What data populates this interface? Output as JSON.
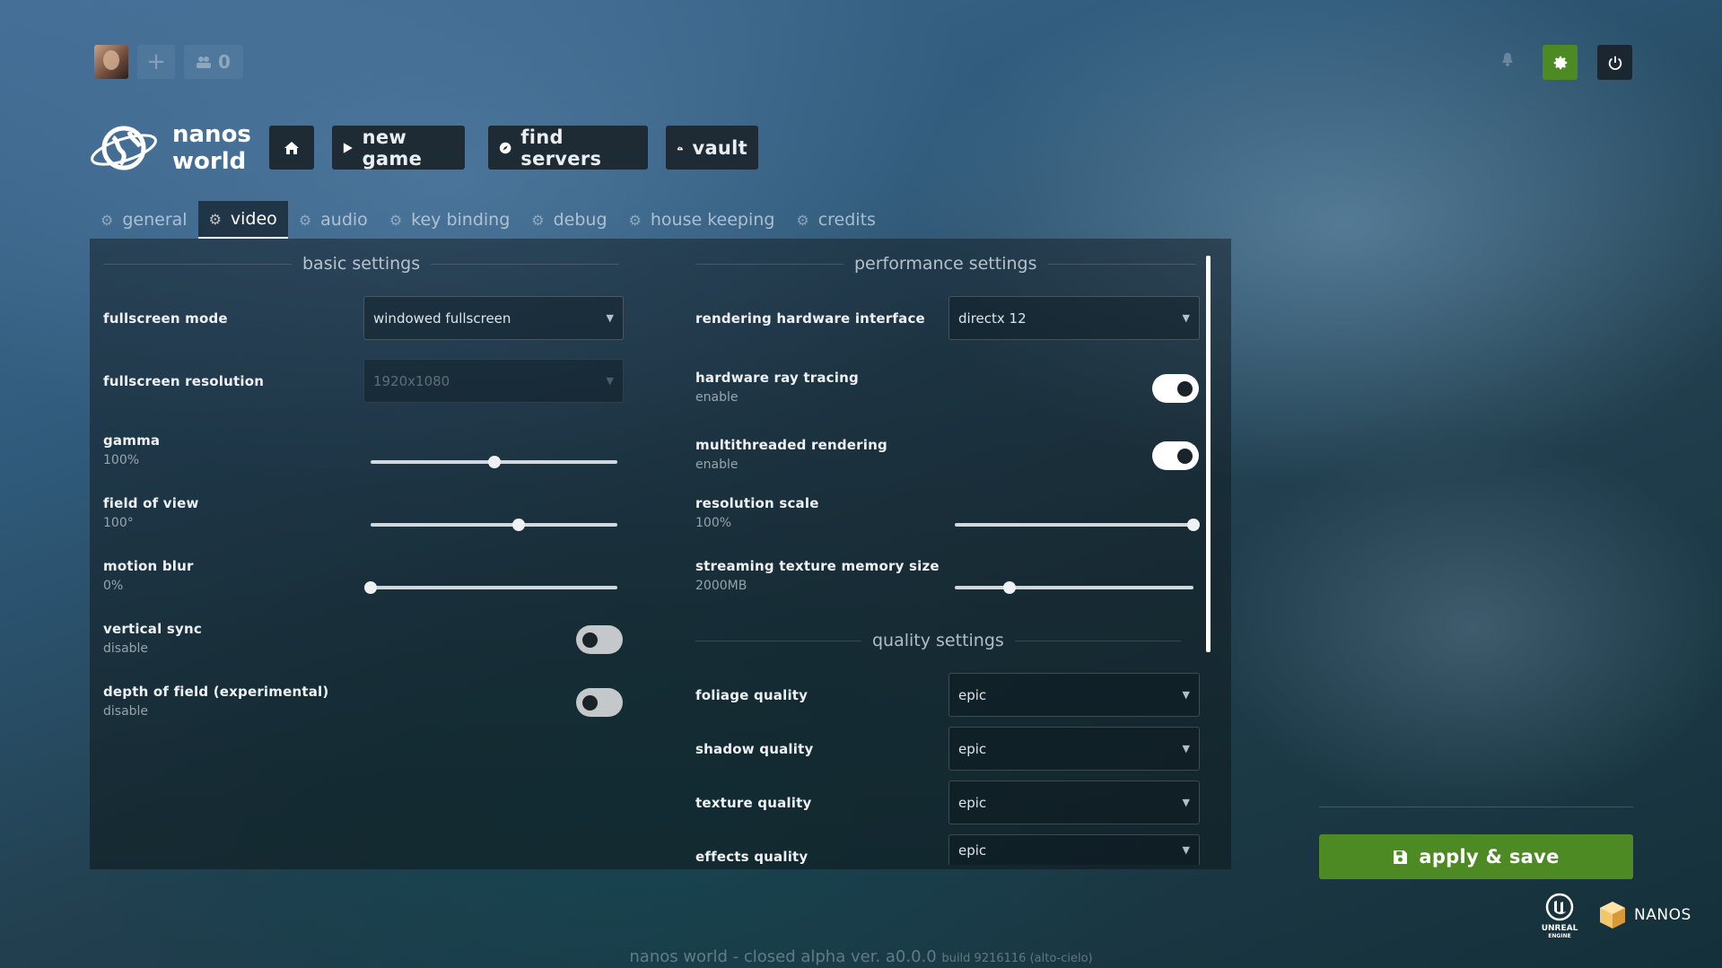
{
  "topbar": {
    "plus_label": "+",
    "friends_count": "0"
  },
  "logo": {
    "line1": "nanos",
    "line2": "world"
  },
  "nav": {
    "new_game": "new game",
    "find_servers": "find servers",
    "vault": "vault"
  },
  "tabs": [
    {
      "label": "general"
    },
    {
      "label": "video"
    },
    {
      "label": "audio"
    },
    {
      "label": "key binding"
    },
    {
      "label": "debug"
    },
    {
      "label": "house keeping"
    },
    {
      "label": "credits"
    }
  ],
  "basic": {
    "title": "basic settings",
    "fullscreen_mode": {
      "label": "fullscreen mode",
      "value": "windowed fullscreen"
    },
    "fullscreen_resolution": {
      "label": "fullscreen resolution",
      "value": "1920x1080"
    },
    "gamma": {
      "label": "gamma",
      "value": "100%",
      "fraction": 0.5
    },
    "fov": {
      "label": "field of view",
      "value": "100°",
      "fraction": 0.6
    },
    "motion_blur": {
      "label": "motion blur",
      "value": "0%",
      "fraction": 0.0
    },
    "vsync": {
      "label": "vertical sync",
      "state": "disable"
    },
    "dof": {
      "label": "depth of field (experimental)",
      "state": "disable"
    }
  },
  "performance": {
    "title": "performance settings",
    "rhi": {
      "label": "rendering hardware interface",
      "value": "directx 12"
    },
    "raytracing": {
      "label": "hardware ray tracing",
      "state": "enable"
    },
    "multithreaded": {
      "label": "multithreaded rendering",
      "state": "enable"
    },
    "resolution_scale": {
      "label": "resolution scale",
      "value": "100%",
      "fraction": 1.0
    },
    "texture_memory": {
      "label": "streaming texture memory size",
      "value": "2000MB",
      "fraction": 0.23
    }
  },
  "quality": {
    "title": "quality settings",
    "foliage": {
      "label": "foliage quality",
      "value": "epic"
    },
    "shadow": {
      "label": "shadow quality",
      "value": "epic"
    },
    "texture": {
      "label": "texture quality",
      "value": "epic"
    },
    "effects": {
      "label": "effects quality",
      "value": "epic"
    }
  },
  "apply_label": "apply & save",
  "brand": {
    "ue_line1": "UNREAL",
    "ue_line2": "ENGINE",
    "nanos": "NANOS"
  },
  "version": {
    "main": "nanos world - closed alpha  ver. a0.0.0",
    "build": "build 9216116  (alto-cielo)"
  },
  "colors": {
    "accent_green": "#4e8a24",
    "dark_button": "#1e2b34"
  }
}
